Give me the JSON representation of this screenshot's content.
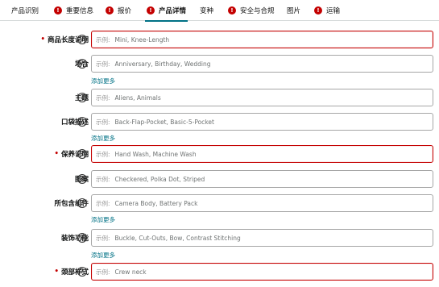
{
  "tabs": [
    {
      "label": "产品识别",
      "alert": false,
      "active": false
    },
    {
      "label": "重要信息",
      "alert": true,
      "active": false
    },
    {
      "label": "报价",
      "alert": true,
      "active": false
    },
    {
      "label": "产品详情",
      "alert": true,
      "active": true
    },
    {
      "label": "变种",
      "alert": false,
      "active": false
    },
    {
      "label": "安全与合规",
      "alert": true,
      "active": false
    },
    {
      "label": "图片",
      "alert": false,
      "active": false
    },
    {
      "label": "运输",
      "alert": true,
      "active": false
    }
  ],
  "alert_color": "#c40000",
  "accent_color": "#007185",
  "help_icon_glyph": "?",
  "required_marker": "•",
  "example_prefix": "示例:",
  "add_more_label": "添加更多",
  "fields": [
    {
      "label": "商品长度说明",
      "required": true,
      "placeholder": "Mini, Knee-Length",
      "value": ""
    },
    {
      "label": "场合",
      "required": false,
      "placeholder": "Anniversary, Birthday, Wedding",
      "value": ""
    },
    {
      "label": "主题",
      "required": false,
      "placeholder": "Aliens, Animals",
      "value": ""
    },
    {
      "label": "口袋描述",
      "required": false,
      "placeholder": "Back-Flap-Pocket, Basic-5-Pocket",
      "value": ""
    },
    {
      "label": "保养说明",
      "required": true,
      "placeholder": "Hand Wash, Machine Wash",
      "value": ""
    },
    {
      "label": "图案",
      "required": false,
      "placeholder": "Checkered, Polka Dot, Striped",
      "value": ""
    },
    {
      "label": "所包含组件",
      "required": false,
      "placeholder": "Camera Body, Battery Pack",
      "value": ""
    },
    {
      "label": "装饰功能",
      "required": false,
      "placeholder": "Buckle, Cut-Outs, Bow, Contrast Stitching",
      "value": ""
    },
    {
      "label": "颈部样式",
      "required": true,
      "placeholder": "Crew neck",
      "value": ""
    }
  ]
}
